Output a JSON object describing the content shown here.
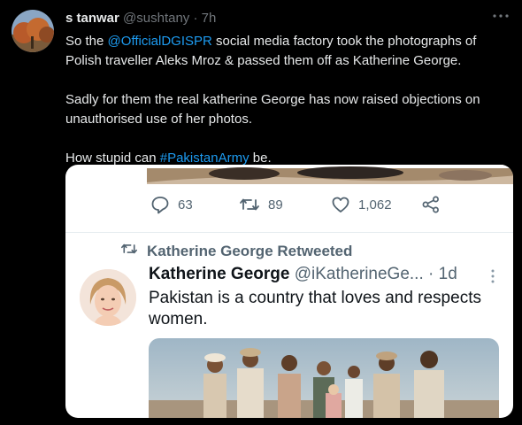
{
  "tweet": {
    "author_name": "s tanwar",
    "author_handle": "@sushtany",
    "separator": "·",
    "time": "7h",
    "text_lines": {
      "l1_pre": "So the ",
      "l1_link": "@OfficialDGISPR",
      "l1_post": " social media factory took the photographs of",
      "l2": "Polish traveller Aleks Mroz & passed them off as Katherine George.",
      "l3": "Sadly for them the real katherine George has now raised objections on",
      "l4": "unauthorised use of her photos.",
      "l5_pre": "How stupid can ",
      "l5_link": "#PakistanArmy",
      "l5_post": " be."
    }
  },
  "embedded": {
    "actions": {
      "replies": "63",
      "retweets": "89",
      "likes": "1,062"
    },
    "retweet_label": "Katherine George Retweeted",
    "inner_tweet": {
      "name": "Katherine George",
      "handle": "@iKatherineGe...",
      "time": "· 1d",
      "text": "Pakistan is a country that loves and respects women."
    }
  },
  "icons": {
    "more": "more-horizontal-icon",
    "reply": "reply-icon",
    "retweet": "retweet-icon",
    "like": "heart-icon",
    "share": "share-icon"
  },
  "colors": {
    "background": "#000000",
    "link": "#1d9bf0",
    "muted": "#71767b",
    "card_background": "#ffffff"
  }
}
